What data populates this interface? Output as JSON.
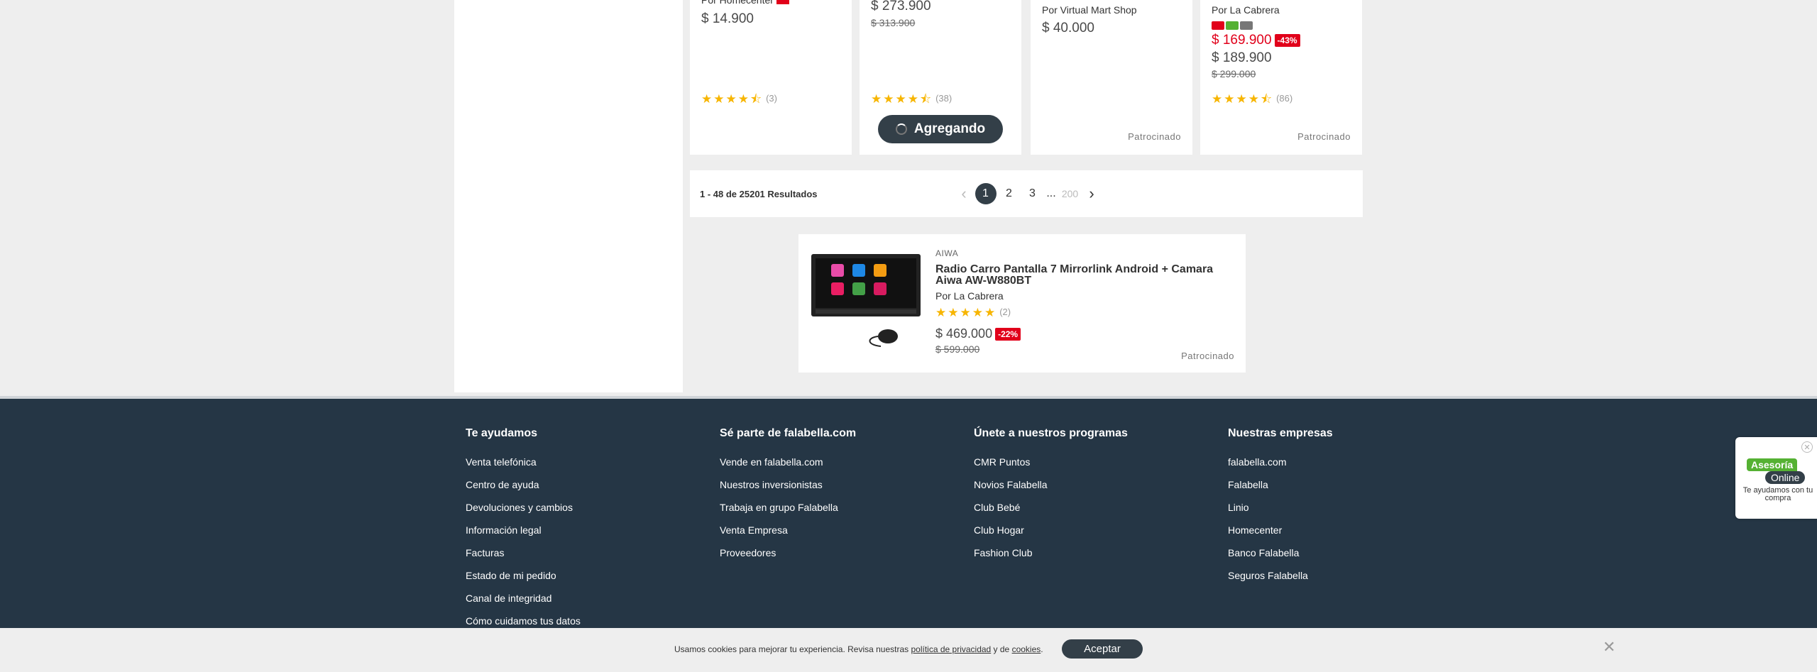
{
  "products": [
    {
      "seller": "Por Homecenter",
      "price": "$ 14.900",
      "rating_count": "(3)"
    },
    {
      "price": "$ 273.900",
      "old_price": "$ 313.900",
      "rating_count": "(38)",
      "button": "Agregando"
    },
    {
      "seller": "Por Virtual Mart Shop",
      "price": "$ 40.000",
      "sponsored": "Patrocinado"
    },
    {
      "seller": "Por La Cabrera",
      "sale_price": "$ 169.900",
      "discount": "-43%",
      "price": "$ 189.900",
      "old_price": "$ 299.000",
      "rating_count": "(86)",
      "sponsored": "Patrocinado"
    }
  ],
  "pagination": {
    "results_bold": "1 - 48 de 25201",
    "results_label": "Resultados",
    "pages": [
      "1",
      "2",
      "3"
    ],
    "ellipsis": "...",
    "last": "200"
  },
  "sponsored_product": {
    "brand": "AIWA",
    "title": "Radio Carro Pantalla 7 Mirrorlink Android + Camara Aiwa AW-W880BT",
    "seller": "Por La Cabrera",
    "rating_count": "(2)",
    "price": "$ 469.000",
    "discount": "-22%",
    "old_price": "$ 599.000",
    "sponsored": "Patrocinado"
  },
  "footer": {
    "columns": [
      {
        "title": "Te ayudamos",
        "links": [
          "Venta telefónica",
          "Centro de ayuda",
          "Devoluciones y cambios",
          "Información legal",
          "Facturas",
          "Estado de mi pedido",
          "Canal de integridad",
          "Cómo cuidamos tus datos"
        ]
      },
      {
        "title": "Sé parte de falabella.com",
        "links": [
          "Vende en falabella.com",
          "Nuestros inversionistas",
          "Trabaja en grupo Falabella",
          "Venta Empresa",
          "Proveedores"
        ]
      },
      {
        "title": "Únete a nuestros programas",
        "links": [
          "CMR Puntos",
          "Novios Falabella",
          "Club Bebé",
          "Club Hogar",
          "Fashion Club"
        ]
      },
      {
        "title": "Nuestras empresas",
        "links": [
          "falabella.com",
          "Falabella",
          "Linio",
          "Homecenter",
          "Banco Falabella",
          "Seguros Falabella"
        ]
      }
    ]
  },
  "chat": {
    "line1": "Asesoría",
    "line2": "Online",
    "caption": "Te ayudamos con tu compra"
  },
  "cookie": {
    "text_before": "Usamos cookies para mejorar tu experiencia. Revisa nuestras ",
    "privacy_link": "política de privacidad",
    "text_middle": " y de ",
    "cookies_link": "cookies",
    "text_after": ".",
    "accept": "Aceptar"
  },
  "colors": {
    "footer_bg": "#253645",
    "sale_red": "#e1001a",
    "button_dark": "#333f48",
    "star": "#f7b500"
  }
}
